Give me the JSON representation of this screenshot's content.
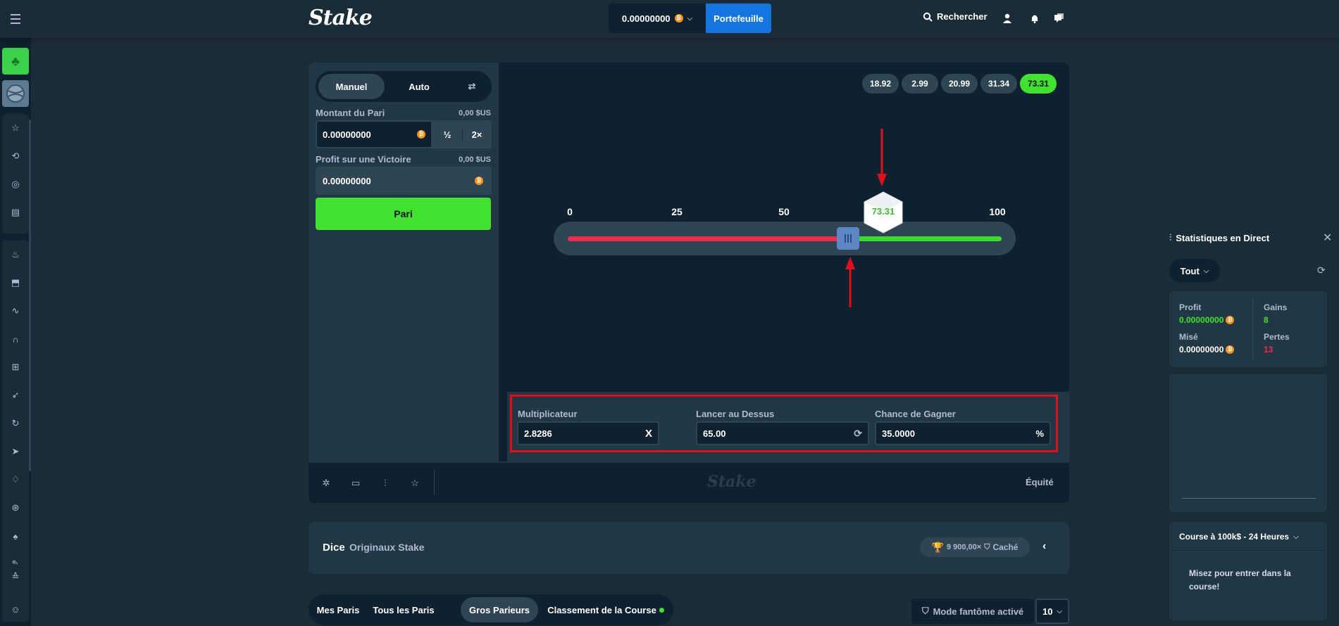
{
  "header": {
    "logo": "Stake",
    "balance": "0.00000000",
    "wallet_label": "Portefeuille",
    "search_label": "Rechercher"
  },
  "controls": {
    "tab_manual": "Manuel",
    "tab_auto": "Auto",
    "bet_amount_label": "Montant du Pari",
    "bet_amount_usd": "0,00 $US",
    "bet_amount_value": "0.00000000",
    "half_label": "½",
    "double_label": "2×",
    "profit_label": "Profit sur une Victoire",
    "profit_usd": "0,00 $US",
    "profit_value": "0.00000000",
    "bet_button": "Pari"
  },
  "history": [
    "18.92",
    "2.99",
    "20.99",
    "31.34",
    "73.31"
  ],
  "history_last_win": true,
  "slider": {
    "ticks": [
      "0",
      "25",
      "50",
      "100"
    ],
    "roll_over": 65.0,
    "result": "73.31",
    "result_value": 73.31
  },
  "inputs": {
    "multiplier_label": "Multiplicateur",
    "multiplier_value": "2.8286",
    "multiplier_suffix": "X",
    "roll_label": "Lancer au Dessus",
    "roll_value": "65.00",
    "chance_label": "Chance de Gagner",
    "chance_value": "35.0000",
    "chance_suffix": "%"
  },
  "game_footer": {
    "watermark": "Stake",
    "fairness": "Équité"
  },
  "info": {
    "game_name": "Dice",
    "game_category": "Originaux Stake",
    "max_win": "9 900,00×",
    "hidden_label": "Caché"
  },
  "bottom_tabs": {
    "my_bets": "Mes Paris",
    "all_bets": "Tous les Paris",
    "high_rollers": "Gros Parieurs",
    "race": "Classement de la Course",
    "ghost_mode": "Mode fantôme activé",
    "page_size": "10"
  },
  "stats": {
    "title": "Statistiques en Direct",
    "filter": "Tout",
    "profit_label": "Profit",
    "profit_value": "0.00000000",
    "wins_label": "Gains",
    "wins_value": "8",
    "wagered_label": "Misé",
    "wagered_value": "0.00000000",
    "losses_label": "Pertes",
    "losses_value": "13",
    "race_title": "Course à 100k$ - 24 Heures",
    "race_text": "Misez pour entrer dans la course!"
  },
  "colors": {
    "accent_green": "#43e12f",
    "accent_blue": "#1475e1",
    "lose_red": "#ea2c4f",
    "annotation_red": "#e0101a"
  }
}
